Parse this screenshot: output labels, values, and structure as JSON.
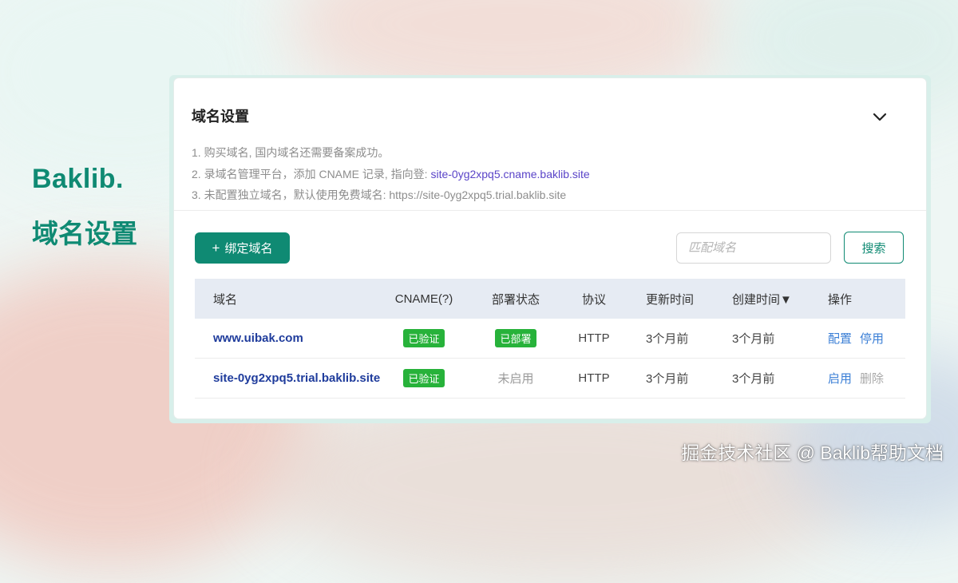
{
  "brand": {
    "logo": "Baklib.",
    "subtitle": "域名设置"
  },
  "card": {
    "title": "域名设置",
    "steps": [
      {
        "text": "1. 购买域名, 国内域名还需要备案成功。",
        "highlight": ""
      },
      {
        "text": "2. 录域名管理平台，添加 CNAME 记录, 指向登: ",
        "highlight": "site-0yg2xpq5.cname.baklib.site"
      },
      {
        "text": "3. 未配置独立域名，默认使用免费域名: https://site-0yg2xpq5.trial.baklib.site",
        "highlight": ""
      }
    ]
  },
  "toolbar": {
    "add_plus": "+",
    "add_label": "绑定域名",
    "search_placeholder": "匹配域名",
    "search_label": "搜索"
  },
  "table": {
    "headers": [
      "域名",
      "CNAME(?)",
      "部署状态",
      "协议",
      "更新时间",
      "创建时间▼",
      "操作"
    ],
    "rows": [
      {
        "domain": "www.uibak.com",
        "cname": "已验证",
        "status": "已部署",
        "status_tag": true,
        "protocol": "HTTP",
        "updated": "3个月前",
        "created": "3个月前",
        "ops": [
          "配置",
          "停用"
        ]
      },
      {
        "domain": "site-0yg2xpq5.trial.baklib.site",
        "cname": "已验证",
        "status": "未启用",
        "status_tag": false,
        "protocol": "HTTP",
        "updated": "3个月前",
        "created": "3个月前",
        "ops": [
          "启用",
          "删除"
        ]
      }
    ]
  },
  "watermark": "掘金技术社区 @ Baklib帮助文档",
  "colors": {
    "brand": "#0f8a73",
    "tag_green": "#27b23a",
    "link_blue": "#1f3c9c",
    "highlight": "#5a44c8"
  },
  "icons": {
    "collapse": "chevron-down-icon"
  }
}
